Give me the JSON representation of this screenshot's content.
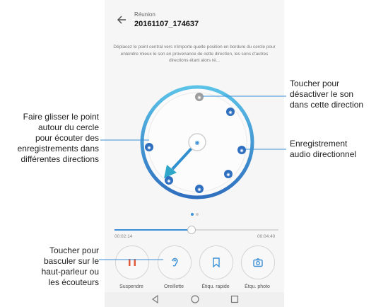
{
  "header": {
    "subtitle": "Réunion",
    "title": "20161107_174637"
  },
  "description": "Déplacez le point central vers n'importe quelle position en bordure du cercle pour entendre mieux le son en provenance de cette direction, les sons d'autres directions étant alors ré...",
  "playback": {
    "elapsed": "00:02:14",
    "total": "00:04:40",
    "progress_fraction": 0.47
  },
  "controls": [
    {
      "label": "Suspendre",
      "icon": "pause-icon"
    },
    {
      "label": "Oreillette",
      "icon": "ear-icon"
    },
    {
      "label": "Étiqu. rapide",
      "icon": "bookmark-icon"
    },
    {
      "label": "Étqu. photo",
      "icon": "camera-icon"
    }
  ],
  "nav": [
    "back-triangle-icon",
    "home-circle-icon",
    "recents-square-icon"
  ],
  "annotations": {
    "left_top": [
      "Faire glisser le point",
      "autour du cercle",
      "pour écouter des",
      "enregistrements dans",
      "différentes directions"
    ],
    "left_bottom": [
      "Toucher pour",
      "basculer sur le",
      "haut-parleur ou",
      "les écouteurs"
    ],
    "right_top": [
      "Toucher pour",
      "désactiver le son",
      "dans cette direction"
    ],
    "right_mid": [
      "Enregistrement",
      "audio directionnel"
    ]
  },
  "colors": {
    "accent": "#3b8fd6",
    "pause": "#e05a3a",
    "ring_light": "#5bc3e8",
    "muted_dot": "#9e9e9e"
  }
}
